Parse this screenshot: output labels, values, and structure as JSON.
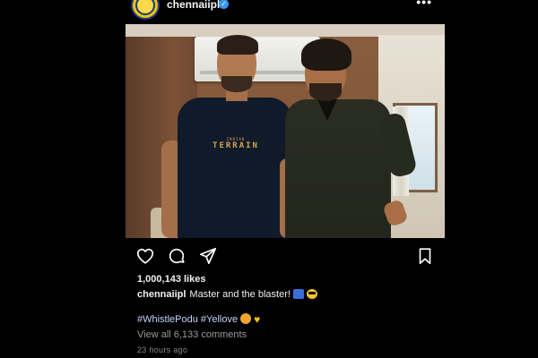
{
  "post": {
    "username": "chennaiipl",
    "more_icon": "more-horizontal-icon",
    "verified_icon": "verified-badge-icon",
    "photo_icon": "post-photo"
  },
  "actions": {
    "like_icon": "heart-icon",
    "comment_icon": "comment-bubble-icon",
    "share_icon": "paper-plane-icon",
    "save_icon": "bookmark-icon"
  },
  "stats": {
    "likes": "1,000,143 likes"
  },
  "caption": {
    "user": "chennaiipl",
    "text": "Master and the blaster!"
  },
  "hashtags": {
    "text": "#WhistlePodu #Yellove"
  },
  "comments": {
    "view_all": "View all 6,133 comments"
  },
  "meta": {
    "posted_ago": "23 hours ago"
  },
  "colors": {
    "background": "#000000",
    "text": "#f2f2f2",
    "muted": "#9a9a9a",
    "verified": "#3897f0",
    "hashtag": "#c8d4ff",
    "brand_yellow": "#f5c400"
  }
}
